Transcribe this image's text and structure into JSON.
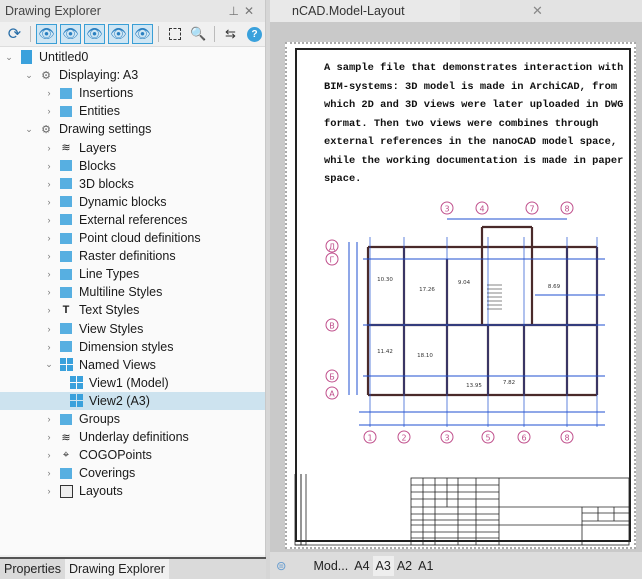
{
  "panel": {
    "title": "Drawing Explorer",
    "pin_icon": "pin-icon",
    "close_icon": "close-icon"
  },
  "toolbar": [
    "refresh-icon",
    "show-all-icon",
    "show-selected-icon",
    "show-filled-icon",
    "show-search-icon",
    "show-solid-icon",
    "select-frame-icon",
    "zoom-object-icon",
    "swap-icon",
    "help-icon"
  ],
  "tree": [
    {
      "label": "Untitled0",
      "level": 0,
      "expanded": true
    },
    {
      "label": "Displaying: A3",
      "level": 1,
      "expanded": true
    },
    {
      "label": "Insertions",
      "level": 2
    },
    {
      "label": "Entities",
      "level": 2
    },
    {
      "label": "Drawing settings",
      "level": 1,
      "expanded": true
    },
    {
      "label": "Layers",
      "level": 2
    },
    {
      "label": "Blocks",
      "level": 2
    },
    {
      "label": "3D blocks",
      "level": 2
    },
    {
      "label": "Dynamic blocks",
      "level": 2
    },
    {
      "label": "External references",
      "level": 2
    },
    {
      "label": "Point cloud definitions",
      "level": 2
    },
    {
      "label": "Raster definitions",
      "level": 2
    },
    {
      "label": "Line Types",
      "level": 2
    },
    {
      "label": "Multiline Styles",
      "level": 2
    },
    {
      "label": "Text Styles",
      "level": 2
    },
    {
      "label": "View Styles",
      "level": 2
    },
    {
      "label": "Dimension styles",
      "level": 2
    },
    {
      "label": "Named Views",
      "level": 2,
      "expanded": true
    },
    {
      "label": "View1 (Model)",
      "level": 3
    },
    {
      "label": "View2 (A3)",
      "level": 3,
      "selected": true
    },
    {
      "label": "Groups",
      "level": 2
    },
    {
      "label": "Underlay definitions",
      "level": 2
    },
    {
      "label": "COGOPoints",
      "level": 2
    },
    {
      "label": "Coverings",
      "level": 2
    },
    {
      "label": "Layouts",
      "level": 2
    }
  ],
  "bottom_tabs": [
    {
      "label": "Properties"
    },
    {
      "label": "Drawing Explorer",
      "active": true
    }
  ],
  "document": {
    "tab_title": "nCAD.Model-Layout (documentation).dwg",
    "description": [
      "A sample file that demonstrates interaction with",
      "BIM-systems: 3D model is made in ArchiCAD, from",
      "which 2D and 3D views were later uploaded in DWG",
      "format. Then two views were combines through",
      "external references in the nanoCAD model space,",
      "while the working documentation is made in paper",
      "space."
    ],
    "grid_top": [
      "3",
      "4",
      "7",
      "8"
    ],
    "grid_bottom": [
      "1",
      "2",
      "3",
      "5",
      "6",
      "8"
    ],
    "grid_left": [
      "Д",
      "Г",
      "В",
      "Б",
      "А"
    ],
    "rooms": [
      "10.30",
      "17.26",
      "9.04",
      "8.69",
      "11.42",
      "18.10",
      "13.95",
      "7.82"
    ]
  },
  "layout_tabs": [
    {
      "label": "Mod..."
    },
    {
      "label": "A4"
    },
    {
      "label": "A3",
      "active": true
    },
    {
      "label": "A2"
    },
    {
      "label": "A1"
    }
  ],
  "colors": {
    "accent": "#3aa1dc",
    "selection": "#cde3ef",
    "grid_bubble": "#c0508c",
    "dimension": "#1f4fd0",
    "wall": "#4a2a2a"
  }
}
